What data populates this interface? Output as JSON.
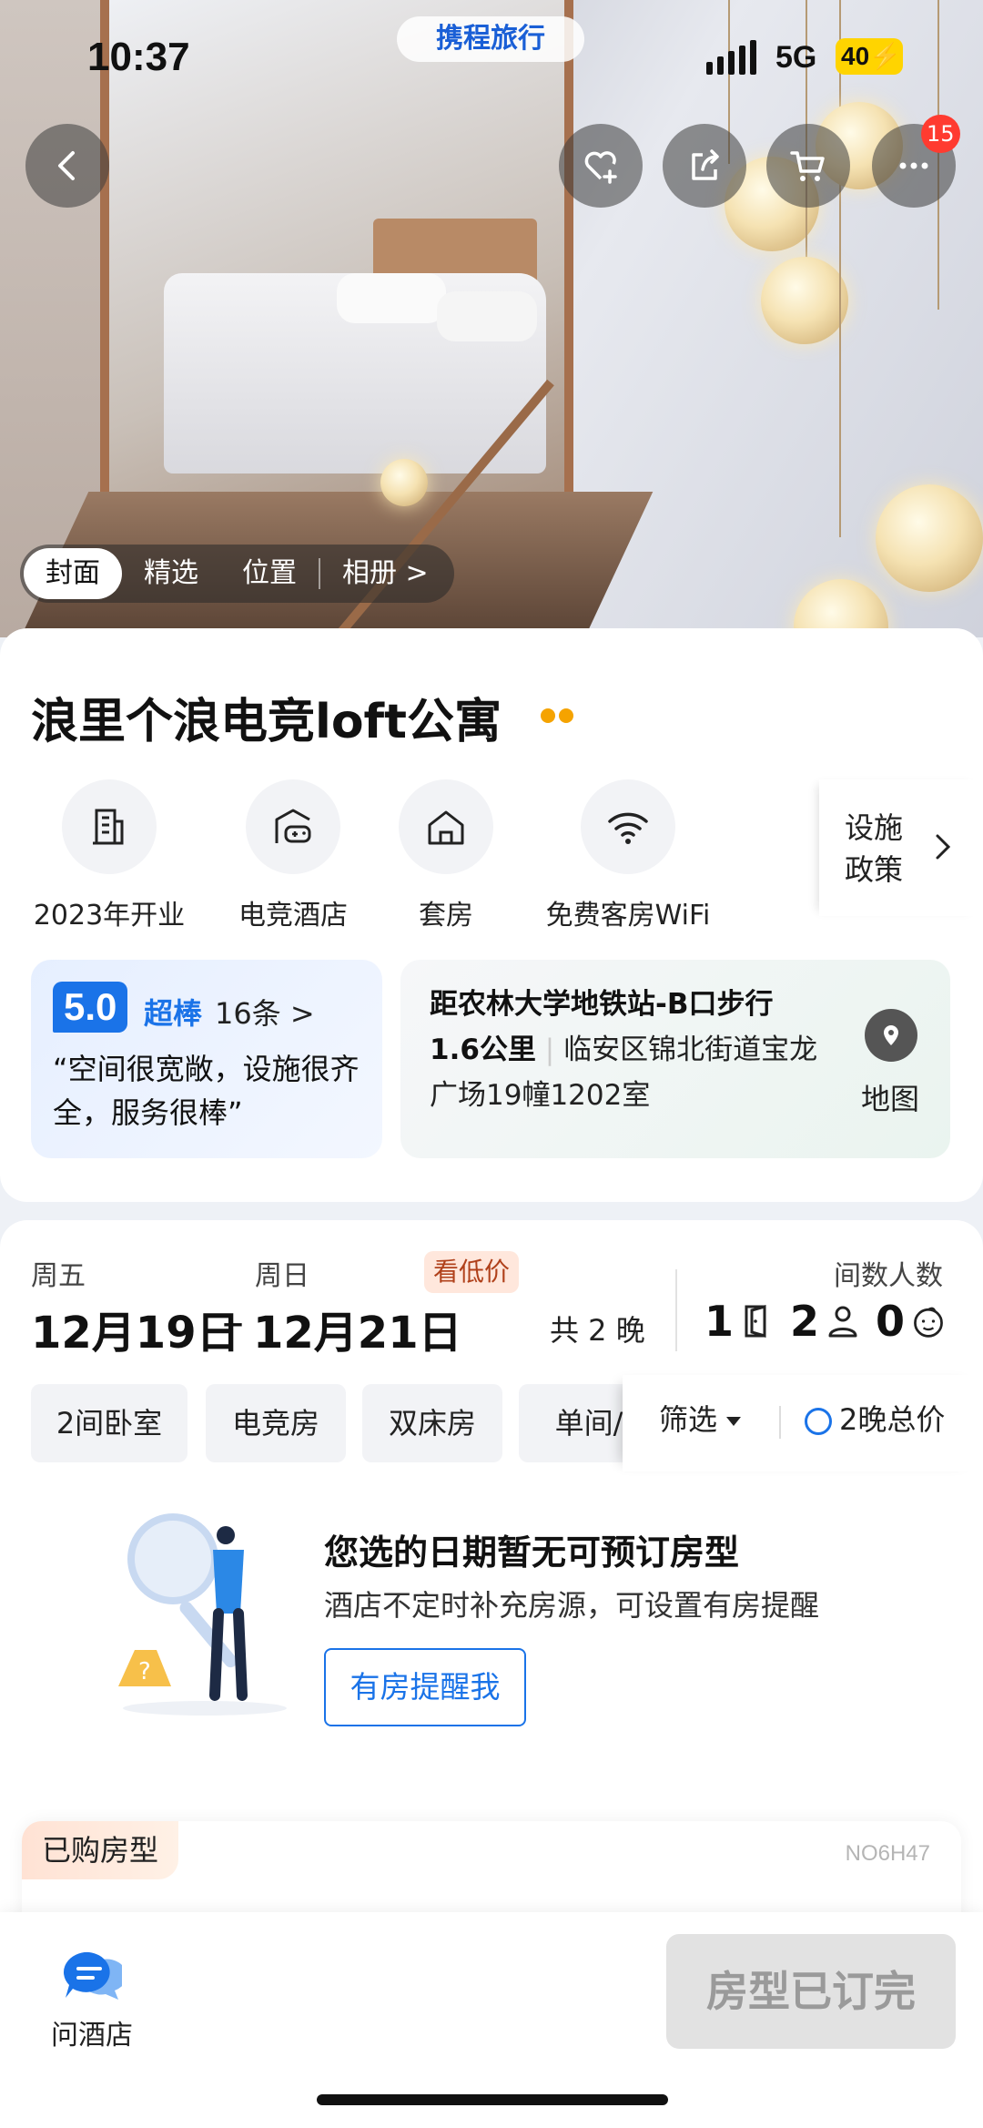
{
  "status_bar": {
    "time": "10:37",
    "network": "5G",
    "battery": "40"
  },
  "brand": "携程旅行",
  "header": {
    "cart_badge": "15"
  },
  "gallery_tabs": [
    "封面",
    "精选",
    "位置",
    "相册 >"
  ],
  "hotel": {
    "name": "浪里个浪电竞loft公寓"
  },
  "facilities": [
    "2023年开业",
    "电竞酒店",
    "套房",
    "免费客房WiFi"
  ],
  "facilities_more": {
    "line1": "设施",
    "line2": "政策"
  },
  "rating": {
    "score": "5.0",
    "word": "超棒",
    "count": "16条 >",
    "quote": "“空间很宽敞，设施很齐全，服务很棒”"
  },
  "location": {
    "prefix": "距农林大学地铁站-B口步行",
    "distance": "1.6公里",
    "address": "临安区锦北街道宝龙广场19幢1202室",
    "map_label": "地图"
  },
  "booking": {
    "checkin_day": "周五",
    "checkin_date": "12月19日",
    "checkout_day": "周日",
    "checkout_date": "12月21日",
    "dash": "–",
    "low_price_tag": "看低价",
    "nights": "共 2 晚",
    "guests_label": "间数人数",
    "rooms": "1",
    "adults": "2",
    "children": "0"
  },
  "filters": {
    "chips": [
      "2间卧室",
      "电竞房",
      "双床房",
      "单间/"
    ],
    "filter_label": "筛选",
    "total_label": "2晚总价"
  },
  "empty_state": {
    "title": "您选的日期暂无可预订房型",
    "desc": "酒店不定时补充房源，可设置有房提醒",
    "button": "有房提醒我"
  },
  "purchased": {
    "tag": "已购房型",
    "code": "NO6H47"
  },
  "bottom": {
    "ask_label": "问酒店",
    "sold_out": "房型已订完"
  },
  "colors": {
    "accent": "#1a73e8",
    "badge": "#ff3b30",
    "star": "#f5a300"
  }
}
